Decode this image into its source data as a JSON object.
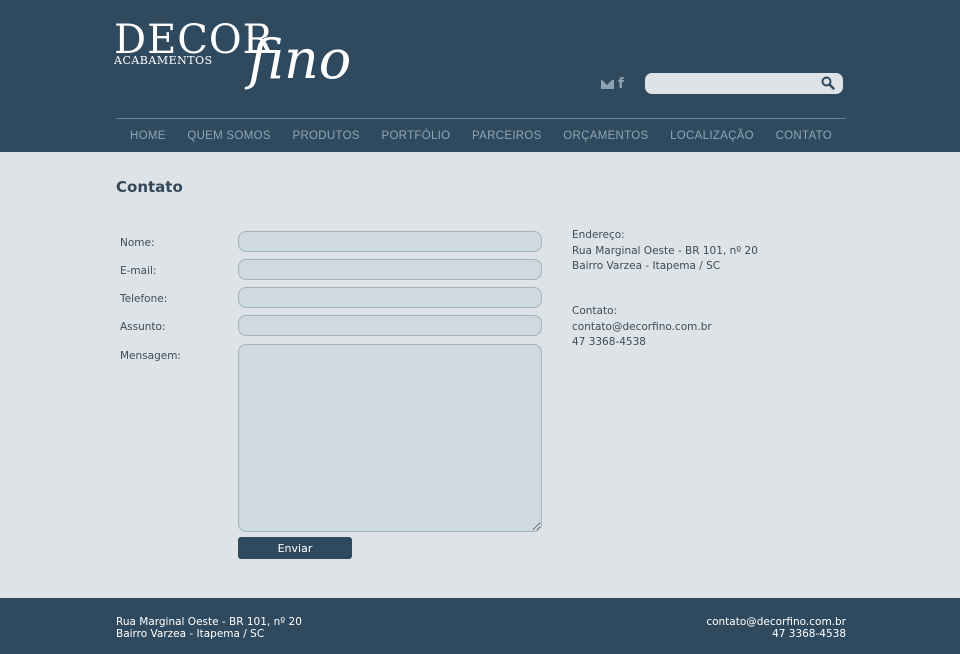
{
  "brand": {
    "name_primary": "DECOR",
    "name_secondary": "ACABAMENTOS",
    "name_script": "fino"
  },
  "header": {
    "social_icons": [
      "mail-icon",
      "facebook-icon"
    ],
    "search": {
      "value": "",
      "placeholder": "",
      "icon": "search-icon"
    }
  },
  "nav": {
    "items": [
      {
        "label": "HOME"
      },
      {
        "label": "QUEM SOMOS"
      },
      {
        "label": "PRODUTOS"
      },
      {
        "label": "PORTFÓLIO"
      },
      {
        "label": "PARCEIROS"
      },
      {
        "label": "ORÇAMENTOS"
      },
      {
        "label": "LOCALIZAÇÃO"
      },
      {
        "label": "CONTATO"
      }
    ]
  },
  "page": {
    "title": "Contato"
  },
  "form": {
    "fields": [
      {
        "label": "Nome:",
        "value": ""
      },
      {
        "label": "E-mail:",
        "value": ""
      },
      {
        "label": "Telefone:",
        "value": ""
      },
      {
        "label": "Assunto:",
        "value": ""
      },
      {
        "label": "Mensagem:",
        "value": ""
      }
    ],
    "submit_label": "Enviar"
  },
  "info": {
    "address_heading": "Endereço:",
    "address_line1": "Rua Marginal Oeste - BR 101, nº 20",
    "address_line2": "Bairro Varzea - Itapema / SC",
    "contact_heading": "Contato:",
    "email": "contato@decorfino.com.br",
    "phone": "47 3368-4538"
  },
  "footer": {
    "address_line1": "Rua Marginal Oeste - BR 101, nº 20",
    "address_line2": "Bairro Varzea - Itapema / SC",
    "email": "contato@decorfino.com.br",
    "phone": "47 3368-4538"
  },
  "colors": {
    "header_bg": "#2f4a5f",
    "page_bg": "#dde3e6",
    "field_bg": "#cfd9e0",
    "nav_text": "#8fa5b5"
  }
}
